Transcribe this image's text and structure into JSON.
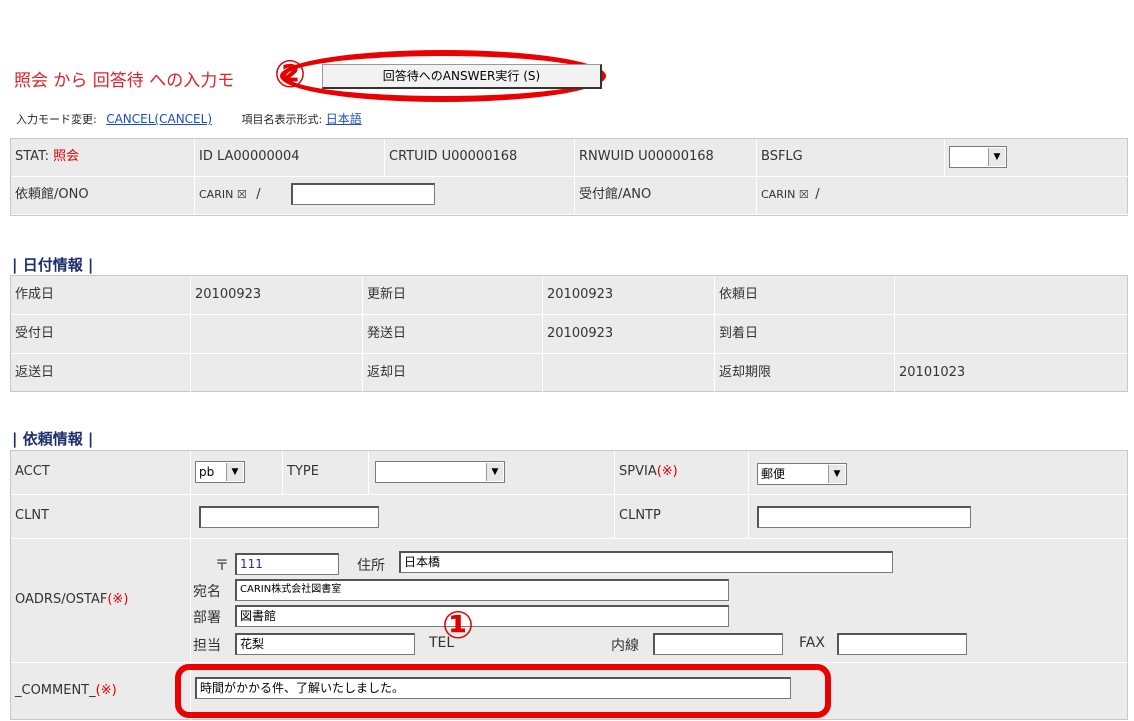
{
  "header": {
    "title": "照会 から 回答待 への入力モード",
    "title_visible": "照会 から 回答待 への入力モ",
    "answer_button": "回答待へのANSWER実行 (S)",
    "marker_2": "②",
    "mode_change_label": "入力モード変更:",
    "mode_change_link": "CANCEL(CANCEL)",
    "display_format_label": "項目名表示形式:",
    "display_format_link": "日本語"
  },
  "status": {
    "stat_label": "STAT:",
    "stat_value": "照会",
    "id": "ID  LA00000004",
    "crtuid": "CRTUID  U00000168",
    "rnwuid": "RNWUID  U00000168",
    "bsflg_label": "BSFLG",
    "bsflg_value": "",
    "irai_label": "依頼館/ONO",
    "carin_lib_1": "CARIN",
    "slash": "/",
    "ono_value": "",
    "ukeke_label": "受付館/ANO",
    "carin_lib_2": "CARIN",
    "box_glyph": "☒",
    "slash2": "/"
  },
  "date_section": {
    "heading": "| 日付情報 |",
    "rows": [
      [
        "作成日",
        "20100923",
        "更新日",
        "20100923",
        "依頼日",
        ""
      ],
      [
        "受付日",
        "",
        "発送日",
        "20100923",
        "到着日",
        ""
      ],
      [
        "返送日",
        "",
        "返却日",
        "",
        "返却期限",
        "20101023"
      ]
    ]
  },
  "request_section": {
    "heading": "| 依頼情報 |",
    "acct_label": "ACCT",
    "acct_value": "pb",
    "type_label": "TYPE",
    "type_value": "",
    "spvia_label": "SPVIA",
    "spvia_value": "郵便",
    "required_mark": "(※)",
    "clnt_label": "CLNT",
    "clnt_value": "",
    "clntp_label": "CLNTP",
    "clntp_value": "",
    "oadrs_label": "OADRS/OSTAF",
    "postal_label": "〒",
    "postal_value": "111",
    "address_label": "住所",
    "address_value": "日本橋",
    "addressee_label": "宛名",
    "addressee_value": "CARIN株式会社図書室",
    "dept_label": "部署",
    "dept_value": "図書館",
    "person_label": "担当",
    "person_value": "花梨",
    "tel_label": "TEL",
    "ext_label": "内線",
    "ext_value": "",
    "fax_label": "FAX",
    "fax_value": "",
    "marker_1": "①",
    "comment_label": "_COMMENT_",
    "comment_value": "時間がかかる件、了解いたしました。"
  },
  "colors": {
    "accent_red": "#e00000",
    "link_blue": "#1a4fbd",
    "cell_bg": "#ebebeb",
    "heading_navy": "#1d2e6a"
  }
}
